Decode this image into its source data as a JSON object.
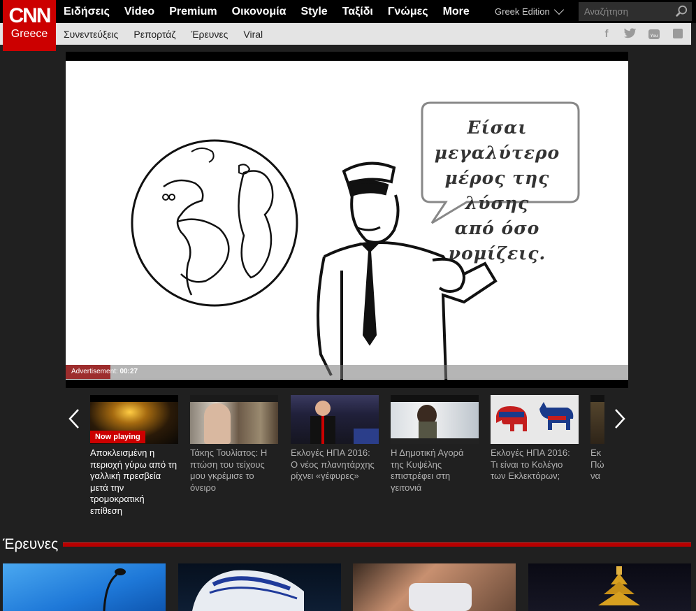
{
  "logo": {
    "brand": "CNN",
    "region": "Greece"
  },
  "main_nav": [
    "Ειδήσεις",
    "Video",
    "Premium",
    "Οικονομία",
    "Style",
    "Ταξίδι",
    "Γνώμες",
    "More"
  ],
  "edition": "Greek Edition",
  "search": {
    "placeholder": "Αναζήτηση"
  },
  "sub_nav": [
    "Συνεντεύξεις",
    "Ρεπορτάζ",
    "Έρευνες",
    "Viral"
  ],
  "social_icons": [
    "facebook-icon",
    "twitter-icon",
    "youtube-icon",
    "rss-icon"
  ],
  "video": {
    "speech_bubble": [
      "Είσαι μεγαλύτερο",
      "μέρος της λύσης",
      "από όσο νομίζεις."
    ],
    "ad_label": "Advertisement:",
    "ad_time": "00:27",
    "ad_progress_fraction": 0.08
  },
  "playlist": [
    {
      "caption": "Αποκλεισμένη η περιοχή γύρω από τη γαλλική πρεσβεία μετά την τρομοκρατική επίθεση",
      "badge": "Now playing",
      "active": true
    },
    {
      "caption": "Τάκης Τουλίατος: Η πτώση του τείχους μου γκρέμισε το όνειρο"
    },
    {
      "caption": "Εκλογές ΗΠΑ 2016: Ο νέος πλανητάρχης ρίχνει «γέφυρες»"
    },
    {
      "caption": "Η Δημοτική Αγορά της Κυψέλης επιστρέφει στη γειτονιά"
    },
    {
      "caption": "Εκλογές ΗΠΑ 2016: Τι είναι το Κολέγιο των Εκλεκτόρων;"
    },
    {
      "caption": "Εκ Πώ να"
    }
  ],
  "section": {
    "title": "Έρευνες"
  },
  "colors": {
    "brand_red": "#cc0000",
    "page_bg": "#202020",
    "nav_bg": "#000000",
    "subnav_bg": "#e4e4e4"
  }
}
